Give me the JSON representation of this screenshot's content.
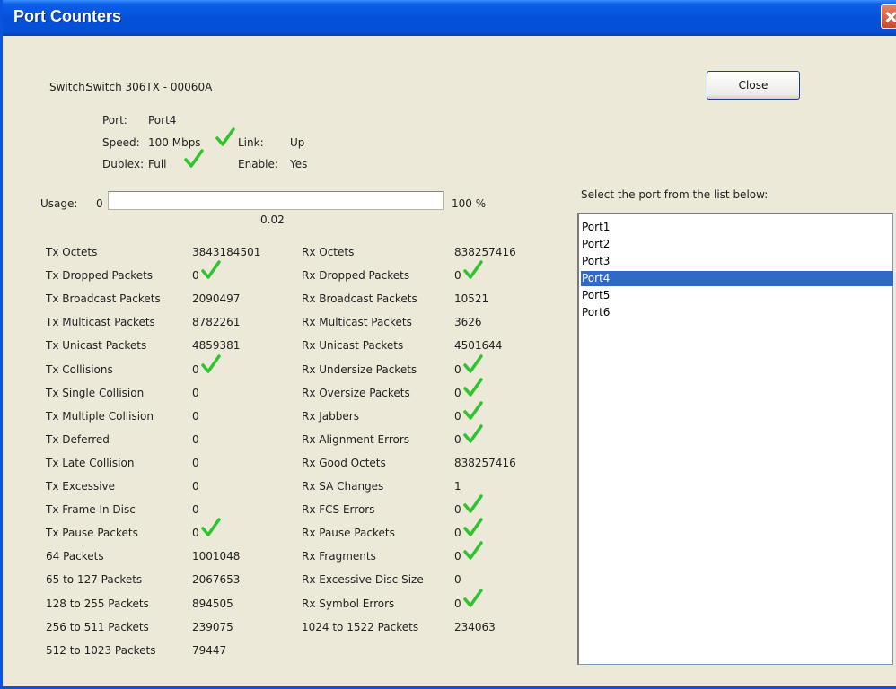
{
  "window": {
    "title": "Port Counters"
  },
  "buttons": {
    "close_label": "Close"
  },
  "switch": {
    "label": "Switch:",
    "value": "Switch 306TX - 00060A"
  },
  "port_info": {
    "port_label": "Port:",
    "port_value": "Port4",
    "speed_label": "Speed:",
    "speed_value": "100 Mbps",
    "link_label": "Link:",
    "link_value": "Up",
    "duplex_label": "Duplex:",
    "duplex_value": "Full",
    "enable_label": "Enable:",
    "enable_value": "Yes"
  },
  "usage": {
    "label": "Usage:",
    "min": "0",
    "max": "100 %",
    "value_text": "0.02",
    "value_percent": 0.02
  },
  "counters_left": [
    {
      "label": "Tx Octets",
      "value": "3843184501",
      "ok": false
    },
    {
      "label": "Tx Dropped Packets",
      "value": "0",
      "ok": true
    },
    {
      "label": "Tx Broadcast Packets",
      "value": "2090497",
      "ok": false
    },
    {
      "label": "Tx Multicast Packets",
      "value": "8782261",
      "ok": false
    },
    {
      "label": "Tx Unicast Packets",
      "value": "4859381",
      "ok": false
    },
    {
      "label": "Tx Collisions",
      "value": "0",
      "ok": true
    },
    {
      "label": "Tx Single Collision",
      "value": "0",
      "ok": false
    },
    {
      "label": "Tx Multiple Collision",
      "value": "0",
      "ok": false
    },
    {
      "label": "Tx Deferred",
      "value": "0",
      "ok": false
    },
    {
      "label": "Tx Late Collision",
      "value": "0",
      "ok": false
    },
    {
      "label": "Tx Excessive",
      "value": "0",
      "ok": false
    },
    {
      "label": "Tx Frame In Disc",
      "value": "0",
      "ok": false
    },
    {
      "label": "Tx Pause Packets",
      "value": "0",
      "ok": true
    },
    {
      "label": "64 Packets",
      "value": "1001048",
      "ok": false
    },
    {
      "label": "65 to 127 Packets",
      "value": "2067653",
      "ok": false
    },
    {
      "label": "128 to 255 Packets",
      "value": "894505",
      "ok": false
    },
    {
      "label": "256 to 511 Packets",
      "value": "239075",
      "ok": false
    },
    {
      "label": "512 to 1023 Packets",
      "value": "79447",
      "ok": false
    }
  ],
  "counters_right": [
    {
      "label": "Rx Octets",
      "value": "838257416",
      "ok": false
    },
    {
      "label": "Rx Dropped Packets",
      "value": "0",
      "ok": true
    },
    {
      "label": "Rx Broadcast Packets",
      "value": "10521",
      "ok": false
    },
    {
      "label": "Rx Multicast Packets",
      "value": "3626",
      "ok": false
    },
    {
      "label": "Rx Unicast Packets",
      "value": "4501644",
      "ok": false
    },
    {
      "label": "Rx Undersize Packets",
      "value": "0",
      "ok": true
    },
    {
      "label": "Rx Oversize Packets",
      "value": "0",
      "ok": true
    },
    {
      "label": "Rx Jabbers",
      "value": "0",
      "ok": true
    },
    {
      "label": "Rx Alignment Errors",
      "value": "0",
      "ok": true
    },
    {
      "label": "Rx Good Octets",
      "value": "838257416",
      "ok": false
    },
    {
      "label": "Rx SA Changes",
      "value": "1",
      "ok": false
    },
    {
      "label": "Rx FCS Errors",
      "value": "0",
      "ok": true
    },
    {
      "label": "Rx Pause Packets",
      "value": "0",
      "ok": true
    },
    {
      "label": "Rx Fragments",
      "value": "0",
      "ok": true
    },
    {
      "label": "Rx Excessive Disc Size",
      "value": "0",
      "ok": false
    },
    {
      "label": "Rx Symbol Errors",
      "value": "0",
      "ok": true
    },
    {
      "label": "1024 to 1522 Packets",
      "value": "234063",
      "ok": false
    }
  ],
  "port_list": {
    "prompt": "Select the port from the list below:",
    "items": [
      "Port1",
      "Port2",
      "Port3",
      "Port4",
      "Port5",
      "Port6"
    ],
    "selected_index": 3
  },
  "colors": {
    "check": "#2fc42f",
    "selection": "#316ac5",
    "titlebar": "#0451d9"
  }
}
